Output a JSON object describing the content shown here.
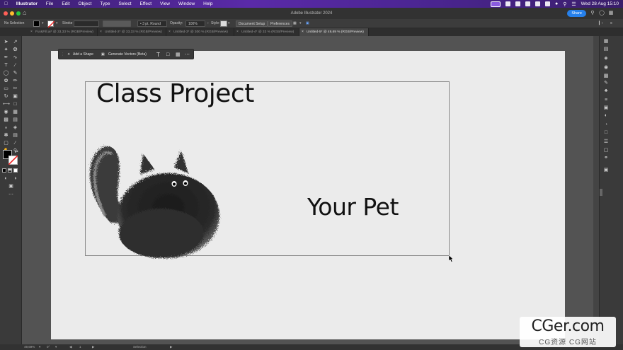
{
  "menubar": {
    "app": "Illustrator",
    "items": [
      "File",
      "Edit",
      "Object",
      "Type",
      "Select",
      "Effect",
      "View",
      "Window",
      "Help"
    ],
    "clock": "Wed 28 Aug  15:10"
  },
  "titlebar": {
    "title": "Adobe Illustrator 2024",
    "share_label": "Share"
  },
  "controlbar": {
    "selection": "No Selection",
    "stroke_label": "Stroke",
    "brush": "3 pt. Round",
    "opacity_label": "Opacity:",
    "opacity_value": "100%",
    "style_label": "Style:",
    "document_setup": "Document Setup",
    "preferences": "Preferences"
  },
  "tabs": [
    {
      "label": "Fur&Fill.ai* @ 33,33 % (RGB/Preview)"
    },
    {
      "label": "Untitled-2* @ 33,33 % (RGB/Preview)"
    },
    {
      "label": "Untitled-3* @ 300 % (RGB/Preview)"
    },
    {
      "label": "Untitled-4* @ 33 % (RGB/Preview)"
    },
    {
      "label": "Untitled-5* @ 49,69 % (RGB/Preview)"
    }
  ],
  "context_bar": {
    "add_shape": "Add a Shape",
    "generate": "Generate Vectors (Beta)"
  },
  "artboard": {
    "heading": "Class Project",
    "subheading": "Your Pet"
  },
  "statusbar": {
    "zoom": "49,69%",
    "rotation": "0°",
    "artboard_num": "1",
    "tool": "Selection"
  },
  "watermark": {
    "title": "CGer.com",
    "subtitle": "CG资源 CG网站"
  },
  "colors": {
    "menubar": "#4a2590",
    "share": "#2680eb",
    "artboard": "#ebebeb",
    "workspace": "#535353"
  }
}
